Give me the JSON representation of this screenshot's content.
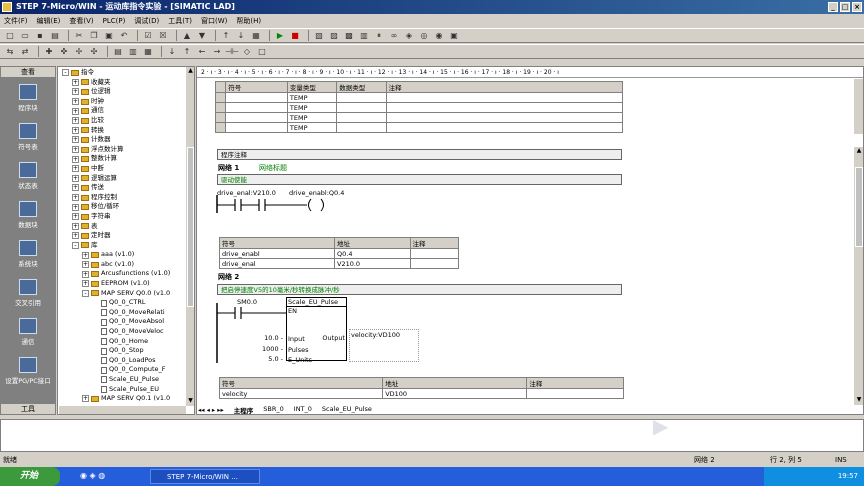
{
  "window": {
    "title": "STEP 7-Micro/WIN - 运动库指令实验 - [SIMATIC LAD]"
  },
  "menu": [
    "文件(F)",
    "编辑(E)",
    "查看(V)",
    "PLC(P)",
    "调试(D)",
    "工具(T)",
    "窗口(W)",
    "帮助(H)"
  ],
  "nav": {
    "header": "查看",
    "items": [
      "程序块",
      "符号表",
      "状态表",
      "数据块",
      "系统块",
      "交叉引用",
      "通信",
      "设置PG/PC接口"
    ],
    "footer": "工具"
  },
  "tree": [
    {
      "indent": 0,
      "pm": "-",
      "kind": "fold",
      "label": "指令"
    },
    {
      "indent": 1,
      "pm": "+",
      "kind": "fold",
      "label": "收藏夹"
    },
    {
      "indent": 1,
      "pm": "+",
      "kind": "fold",
      "label": "位逻辑"
    },
    {
      "indent": 1,
      "pm": "+",
      "kind": "fold",
      "label": "时钟"
    },
    {
      "indent": 1,
      "pm": "+",
      "kind": "fold",
      "label": "通信"
    },
    {
      "indent": 1,
      "pm": "+",
      "kind": "fold",
      "label": "比较"
    },
    {
      "indent": 1,
      "pm": "+",
      "kind": "fold",
      "label": "转换"
    },
    {
      "indent": 1,
      "pm": "+",
      "kind": "fold",
      "label": "计数器"
    },
    {
      "indent": 1,
      "pm": "+",
      "kind": "fold",
      "label": "浮点数计算"
    },
    {
      "indent": 1,
      "pm": "+",
      "kind": "fold",
      "label": "整数计算"
    },
    {
      "indent": 1,
      "pm": "+",
      "kind": "fold",
      "label": "中断"
    },
    {
      "indent": 1,
      "pm": "+",
      "kind": "fold",
      "label": "逻辑运算"
    },
    {
      "indent": 1,
      "pm": "+",
      "kind": "fold",
      "label": "传送"
    },
    {
      "indent": 1,
      "pm": "+",
      "kind": "fold",
      "label": "程序控制"
    },
    {
      "indent": 1,
      "pm": "+",
      "kind": "fold",
      "label": "移位/循环"
    },
    {
      "indent": 1,
      "pm": "+",
      "kind": "fold",
      "label": "字符串"
    },
    {
      "indent": 1,
      "pm": "+",
      "kind": "fold",
      "label": "表"
    },
    {
      "indent": 1,
      "pm": "+",
      "kind": "fold",
      "label": "定时器"
    },
    {
      "indent": 1,
      "pm": "-",
      "kind": "fold",
      "label": "库"
    },
    {
      "indent": 2,
      "pm": "+",
      "kind": "fold",
      "label": "aaa (v1.0)"
    },
    {
      "indent": 2,
      "pm": "+",
      "kind": "fold",
      "label": "abc (v1.0)"
    },
    {
      "indent": 2,
      "pm": "+",
      "kind": "fold",
      "label": "Arcusfunctions (v1.0)"
    },
    {
      "indent": 2,
      "pm": "+",
      "kind": "fold",
      "label": "EEPROM (v1.0)"
    },
    {
      "indent": 2,
      "pm": "-",
      "kind": "fold",
      "label": "MAP SERV Q0.0 (v1.0"
    },
    {
      "indent": 3,
      "pm": "",
      "kind": "file",
      "label": "Q0_0_CTRL"
    },
    {
      "indent": 3,
      "pm": "",
      "kind": "file",
      "label": "Q0_0_MoveRelati"
    },
    {
      "indent": 3,
      "pm": "",
      "kind": "file",
      "label": "Q0_0_MoveAbsol"
    },
    {
      "indent": 3,
      "pm": "",
      "kind": "file",
      "label": "Q0_0_MoveVeloc"
    },
    {
      "indent": 3,
      "pm": "",
      "kind": "file",
      "label": "Q0_0_Home"
    },
    {
      "indent": 3,
      "pm": "",
      "kind": "file",
      "label": "Q0_0_Stop"
    },
    {
      "indent": 3,
      "pm": "",
      "kind": "file",
      "label": "Q0_0_LoadPos"
    },
    {
      "indent": 3,
      "pm": "",
      "kind": "file",
      "label": "Q0_0_Compute_F"
    },
    {
      "indent": 3,
      "pm": "",
      "kind": "file",
      "label": "Scale_EU_Pulse"
    },
    {
      "indent": 3,
      "pm": "",
      "kind": "file",
      "label": "Scale_Pulse_EU"
    },
    {
      "indent": 2,
      "pm": "+",
      "kind": "fold",
      "label": "MAP SERV Q0.1 (v1.0"
    }
  ],
  "ruler": "2 · ı · 3 · ı · 4 · ı · 5 · ı · 6 · ı · 7 · ı · 8 · ı · 9 · ı · 10 · ı · 11 · ı · 12 · ı · 13 · ı · 14 · ı · 15 · ı · 16 · ı · 17 · ı · 18 · ı · 19 · ı · 20 · ı",
  "vartable": {
    "headers": [
      "符号",
      "变量类型",
      "数据类型",
      "注释"
    ],
    "rows": [
      "TEMP",
      "TEMP",
      "TEMP",
      "TEMP"
    ]
  },
  "program_comment": "程序注释",
  "net1": {
    "label": "网络 1",
    "title": "网络标题",
    "comment": "驱动使能",
    "c1": "drive_enal:V210.0",
    "c2": "drive_enabl:Q0.4",
    "symtable": {
      "headers": [
        "符号",
        "地址",
        "注释"
      ],
      "rows": [
        [
          "drive_enabl",
          "Q0.4",
          ""
        ],
        [
          "drive_enal",
          "V210.0",
          ""
        ]
      ]
    }
  },
  "net2": {
    "label": "网络 2",
    "comment": "把启停速度V5的10毫米/秒转换成脉冲/秒",
    "contact": "SM0.0",
    "box_title": "Scale_EU_Pulse",
    "en": "EN",
    "pins": [
      {
        "val": "10.0",
        "name": "Input"
      },
      {
        "val": "1000",
        "name": "Pulses"
      },
      {
        "val": "5.0",
        "name": "E_Units"
      }
    ],
    "out_name": "Output",
    "out_val": "velocity:VD100",
    "symtable": {
      "headers": [
        "符号",
        "地址",
        "注释"
      ],
      "rows": [
        [
          "velocity",
          "VD100",
          ""
        ]
      ]
    }
  },
  "tabs": [
    "主程序",
    "SBR_0",
    "INT_0",
    "Scale_EU_Pulse"
  ],
  "status": {
    "left": "就绪",
    "net": "网络 2",
    "pos": "行 2, 列 5",
    "mode": "INS"
  },
  "taskbar": {
    "start": "开始",
    "task": "STEP 7-Micro/WIN ...",
    "clock": "19:57"
  }
}
